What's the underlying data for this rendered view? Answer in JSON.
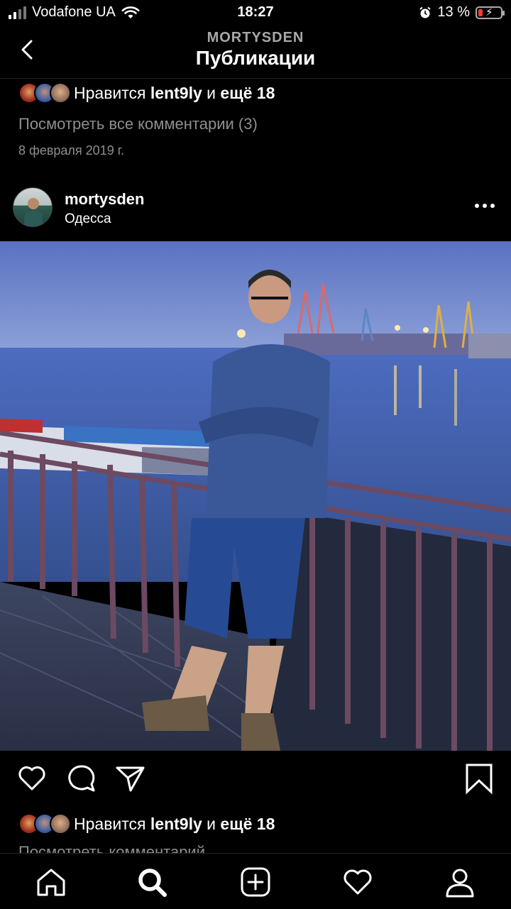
{
  "status_bar": {
    "carrier": "Vodafone UA",
    "time": "18:27",
    "battery_percent": "13 %",
    "icons": [
      "signal-icon",
      "wifi-icon",
      "alarm-icon",
      "battery-icon"
    ]
  },
  "header": {
    "subtitle": "MORTYSDEN",
    "title": "Публикации",
    "back_icon": "chevron-left-icon"
  },
  "prev_post": {
    "likes_prefix": "Нравится ",
    "likes_user": "lent9ly",
    "likes_mid": " и ",
    "likes_more": "ещё 18",
    "view_comments": "Посмотреть все комментарии (3)",
    "date": "8 февраля 2019 г."
  },
  "post": {
    "username": "mortysden",
    "location": "Одесса",
    "more_icon": "more-horizontal-icon",
    "photo": "photo of a young man standing at a railing by Odessa port at dusk",
    "actions": [
      "heart-icon",
      "comment-icon",
      "share-icon",
      "bookmark-icon"
    ],
    "likes_prefix": "Нравится ",
    "likes_user": "lent9ly",
    "likes_mid": " и ",
    "likes_more": "ещё 18",
    "comments_cut": "Посмотреть комментарий"
  },
  "tab_bar": {
    "items": [
      "home-icon",
      "search-icon",
      "add-icon",
      "activity-icon",
      "profile-icon"
    ],
    "active": "search-icon"
  },
  "colors": {
    "background": "#000000",
    "secondary_text": "#8e8e8e",
    "battery_low": "#ff3b30"
  }
}
